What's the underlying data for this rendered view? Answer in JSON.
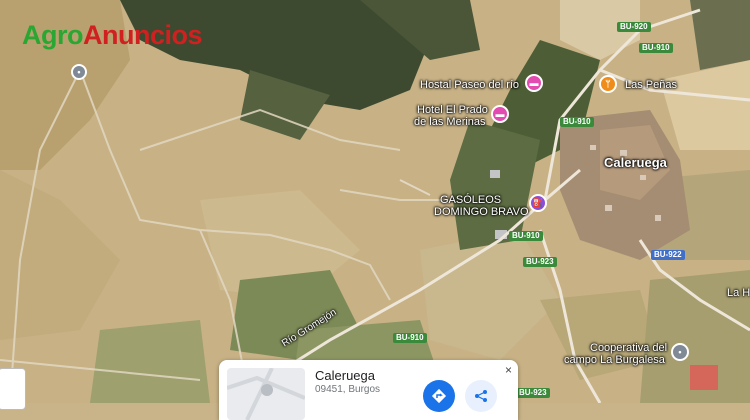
{
  "logo": {
    "part1": "Agro",
    "part2": "Anuncios"
  },
  "places": {
    "hostal": "Hostal Paseo del río",
    "hotel_line1": "Hotel El Prado",
    "hotel_line2": "de las Merinas",
    "las_penas": "Las Peñas",
    "town": "Caleruega",
    "gas_line1": "GASÓLEOS",
    "gas_line2": "DOMINGO BRAVO",
    "coop_line1": "Cooperativa del",
    "coop_line2": "campo La Burgalesa",
    "river": "Río Gromejón",
    "edge_label": "La H"
  },
  "roads": {
    "bu920": "BU-920",
    "bu910_a": "BU-910",
    "bu910_b": "BU-910",
    "bu910_c": "BU-910",
    "bu910_d": "BU-910",
    "bu923_a": "BU-923",
    "bu923_b": "BU-923",
    "bu922": "BU-922"
  },
  "card": {
    "title": "Caleruega",
    "subtitle": "09451, Burgos",
    "close": "×"
  },
  "icons": {
    "hotel": "bed-icon",
    "restaurant": "fork-knife-icon",
    "gas": "gas-pump-icon",
    "location": "location-pin-icon",
    "directions": "directions-icon",
    "share": "share-icon"
  },
  "colors": {
    "field": "#c9b489",
    "forest": "#3c4a2e",
    "road": "#e4ddcc",
    "hotel_pin": "#e24bb0",
    "food_pin": "#f08c1a",
    "gas_pin": "#8a4fd6",
    "road_shield": "#3b8a3b",
    "primary_blue": "#1a73e8"
  }
}
